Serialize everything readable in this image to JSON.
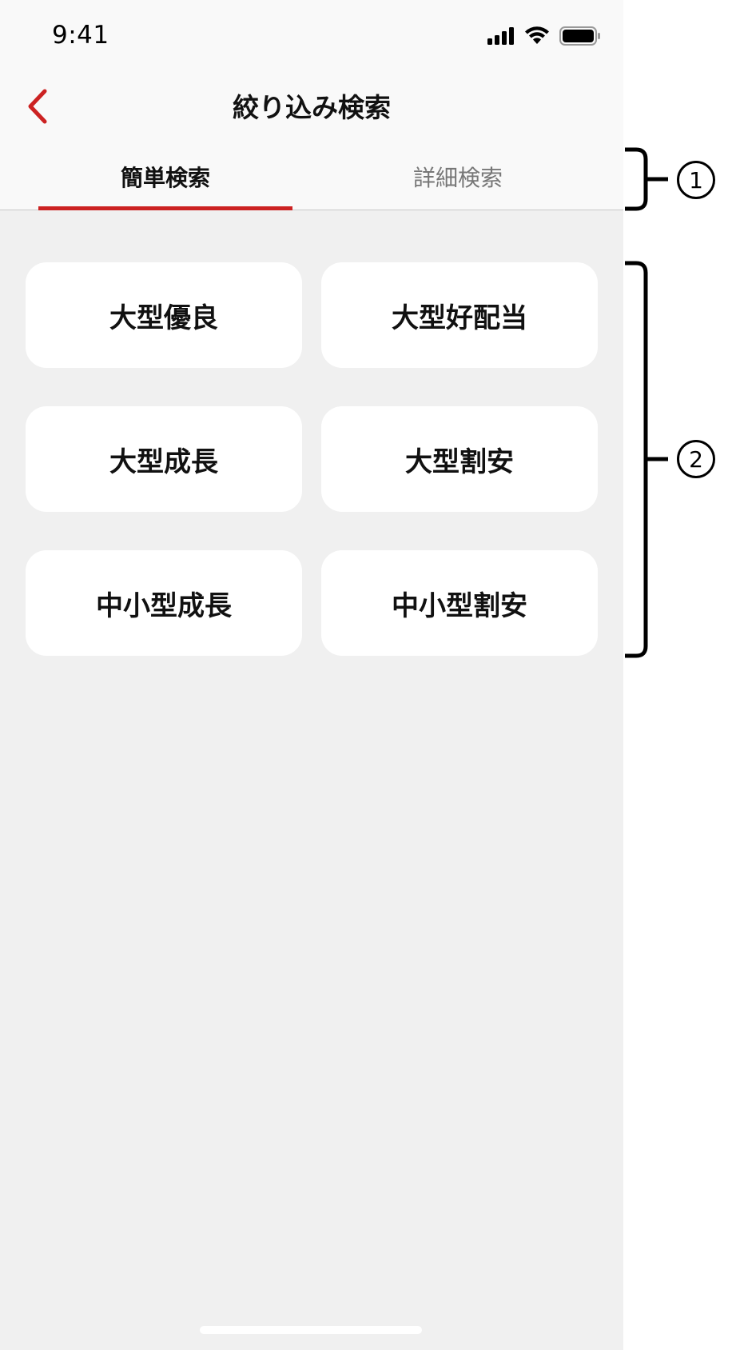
{
  "status_bar": {
    "time": "9:41",
    "icons": [
      "signal-icon",
      "wifi-icon",
      "battery-icon"
    ]
  },
  "nav": {
    "back_icon": "chevron-left-icon",
    "title": "絞り込み検索"
  },
  "tabs": [
    {
      "label": "簡単検索",
      "active": true
    },
    {
      "label": "詳細検索",
      "active": false
    }
  ],
  "presets": [
    {
      "label": "大型優良"
    },
    {
      "label": "大型好配当"
    },
    {
      "label": "大型成長"
    },
    {
      "label": "大型割安"
    },
    {
      "label": "中小型成長"
    },
    {
      "label": "中小型割安"
    }
  ],
  "annotations": [
    {
      "number": "1"
    },
    {
      "number": "2"
    }
  ],
  "colors": {
    "accent": "#cc2222",
    "background": "#f0f0f0",
    "header": "#f9f9f9",
    "card": "#ffffff"
  }
}
